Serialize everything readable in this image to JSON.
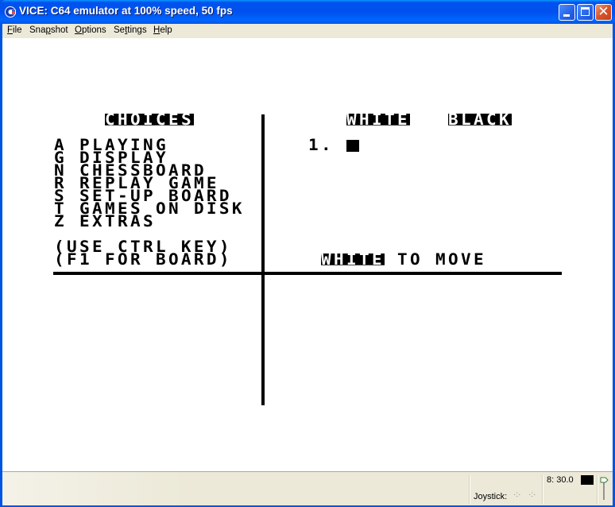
{
  "window": {
    "title": "VICE: C64 emulator at 100% speed, 50 fps",
    "app_icon": "commodore-logo-icon",
    "controls": {
      "minimize": "minimize-icon",
      "maximize": "maximize-icon",
      "close": "close-icon",
      "close_glyph": "✕"
    }
  },
  "menubar": {
    "items": [
      {
        "label": "File",
        "mnemonic": "F"
      },
      {
        "label": "Snapshot",
        "mnemonic": "p"
      },
      {
        "label": "Options",
        "mnemonic": "O"
      },
      {
        "label": "Settings",
        "mnemonic": "t"
      },
      {
        "label": "Help",
        "mnemonic": "H"
      }
    ]
  },
  "c64_screen": {
    "choices_header": "CHOICES",
    "menu_options": [
      {
        "key": "A",
        "label": "PLAYING"
      },
      {
        "key": "G",
        "label": "DISPLAY"
      },
      {
        "key": "N",
        "label": "CHESSBOARD"
      },
      {
        "key": "R",
        "label": "REPLAY GAME"
      },
      {
        "key": "S",
        "label": "SET-UP BOARD"
      },
      {
        "key": "T",
        "label": "GAMES ON DISK"
      },
      {
        "key": "Z",
        "label": "EXTRAS"
      }
    ],
    "hint_ctrl": "(USE CTRL KEY)",
    "hint_f1": "(F1 FOR BOARD)",
    "white_header": "WHITE",
    "black_header": "BLACK",
    "move_number": "1.",
    "cursor": " ",
    "turn_color": "WHITE",
    "turn_text": " TO MOVE"
  },
  "statusbar": {
    "drive_label": "8: 30.0",
    "joystick_label": "Joystick:",
    "joystick_indicator_1": "·:·",
    "joystick_indicator_2": "·:·",
    "drive_led_color": "#000000"
  }
}
